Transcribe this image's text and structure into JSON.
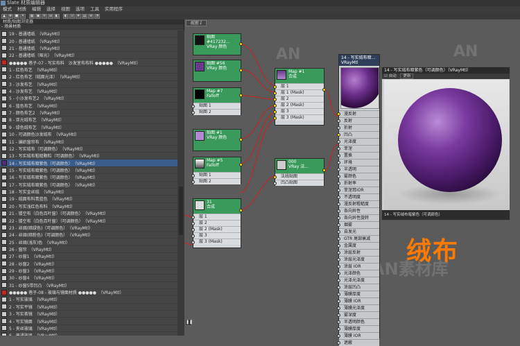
{
  "window_title": "Slate 材质编辑器",
  "menu": [
    "模式",
    "材质",
    "编辑",
    "选择",
    "视图",
    "选项",
    "工具",
    "实用程序"
  ],
  "toolbar_icons": [
    "select-icon",
    "pan-icon",
    "assign-icon",
    "delete-icon",
    "show-map-icon",
    "show-bg-icon",
    "layout-icon",
    "layout-child-icon",
    "nav-icon",
    "options-icon",
    "render-icon",
    "material-id-icon",
    "map-icon",
    "zoom-icon",
    "search-icon"
  ],
  "toolbar_labels": [
    "▲",
    "✥",
    "■",
    "✕",
    "▦",
    "▣",
    "≡",
    "⊞",
    "◧",
    "◐",
    "⊙",
    "#",
    "▤",
    "⊕",
    "◔"
  ],
  "left_panel": {
    "title": "材质/贴图浏览器",
    "section": "- 场景材质",
    "items": [
      {
        "label": "19 - 普通墙纸　（VRayMtl）",
        "color": "#cccccc"
      },
      {
        "label": "20 - 普通墙纸　（VRayMtl）",
        "color": "#cccccc"
      },
      {
        "label": "21 - 普通墙纸　（VRayMtl）",
        "color": "#cccccc"
      },
      {
        "label": "22 - 普通墙纸（哑光）　（VRayMtl）",
        "color": "#cccccc"
      },
      {
        "label": "●●●●● 巷子-07 - 写实布料　沙发室布布料 ●●●●●　（VRayMtl）",
        "color": "#cc2222"
      },
      {
        "label": "1 - 红色布艺　（VRayMtl）",
        "color": "#cccccc"
      },
      {
        "label": "2 - 红色布艺（绒面光泽）　（VRayMtl）",
        "color": "#cccccc"
      },
      {
        "label": "3 - 沙发布艺　（VRayMtl）",
        "color": "#cccccc"
      },
      {
        "label": "4 - 沙发布艺　（VRayMtl）",
        "color": "#cccccc"
      },
      {
        "label": "5 - 小沙发布艺2　（VRayMtl）",
        "color": "#cccccc"
      },
      {
        "label": "6 - 蓝色布艺　（VRayMtl）",
        "color": "#cccccc"
      },
      {
        "label": "7 - 颜色布艺2　（VRayMtl）",
        "color": "#cccccc"
      },
      {
        "label": "8 - 亚光绒布艺　（VRayMtl）",
        "color": "#cccccc"
      },
      {
        "label": "9 - 绿色绒布艺　（VRayMtl）",
        "color": "#cccccc"
      },
      {
        "label": "10 - 可调颜色沙发绒布　（VRayMtl）",
        "color": "#cccccc"
      },
      {
        "label": "11 - 编织窗帘布　（VRayMtl）",
        "color": "#cccccc"
      },
      {
        "label": "12 - 写实绒布（可调颜色）　（VRayMtl）",
        "color": "#cccccc"
      },
      {
        "label": "13 - 写实绒布粗糙颗粒（可调颜色）　（VRayMtl）",
        "color": "#cccccc"
      },
      {
        "label": "14 - 写实绒布暗紫色（可调颜色）　（VRayMtl）",
        "color": "#5a2a7a",
        "selected": true
      },
      {
        "label": "15 - 写实绒布暗紫色（可调颜色）　（VRayMtl）",
        "color": "#cccccc"
      },
      {
        "label": "16 - 写实绒布暗紫色（可调颜色）　（VRayMtl）",
        "color": "#cccccc"
      },
      {
        "label": "17 - 写实绒布暗紫色（可调颜色）　（VRayMtl）",
        "color": "#cccccc"
      },
      {
        "label": "18 - 写实金丝绒　（VRayMtl）",
        "color": "#cccccc"
      },
      {
        "label": "19 - 绒面布料青蓝色　（VRayMtl）",
        "color": "#cccccc"
      },
      {
        "label": "20 - 写实浅红色布料　（VRayMtl）",
        "color": "#cccccc"
      },
      {
        "label": "21 - 镂空布（白色百叶窗）（可调颜色）　（VRayMtl）",
        "color": "#cccccc"
      },
      {
        "label": "22 - 镂空布（白色百叶窗）（可调颜色）　（VRayMtl）",
        "color": "#cccccc"
      },
      {
        "label": "23 - 丝绸(暗绿色)（可调颜色）　（VRayMtl）",
        "color": "#cccccc"
      },
      {
        "label": "24 - 丝绸(暗粉色)（可调颜色）　（VRayMtl）",
        "color": "#cccccc"
      },
      {
        "label": "25 - 丝绸(浅灰)色　（VRayMtl）",
        "color": "#cccccc"
      },
      {
        "label": "26 - 窗帘　（VRayMtl）",
        "color": "#cccccc"
      },
      {
        "label": "27 - 纱窗1　（VRayMtl）",
        "color": "#cccccc"
      },
      {
        "label": "28 - 纱窗2　（VRayMtl）",
        "color": "#cccccc"
      },
      {
        "label": "29 - 纱窗3　（VRayMtl）",
        "color": "#cccccc"
      },
      {
        "label": "30 - 纱窗4　（VRayMtl）",
        "color": "#cccccc"
      },
      {
        "label": "31 - 纱窗5带凹凸　（VRayMtl）",
        "color": "#cccccc"
      },
      {
        "label": "●●●●● 巷子-08 - 玻璃与镜面材质 ●●●●●　（VRayMtl）",
        "color": "#cc2222"
      },
      {
        "label": "1 - 写实玻璃　（VRayMtl）",
        "color": "#cccccc"
      },
      {
        "label": "2 - 写实平镜　（VRayMtl）",
        "color": "#cccccc"
      },
      {
        "label": "3 - 写实茶镜　（VRayMtl）",
        "color": "#cccccc"
      },
      {
        "label": "4 - 写实镜面　（VRayMtl）",
        "color": "#cccccc"
      },
      {
        "label": "5 - 夹丝玻璃　（VRayMtl）",
        "color": "#cccccc"
      },
      {
        "label": "6 - 普通玻璃　（VRayMtl）",
        "color": "#cccccc"
      },
      {
        "label": "7 - 普通玻璃　（VRayMtl）",
        "color": "#cccccc"
      }
    ]
  },
  "view_tab": "视图 1",
  "nodes": {
    "map1": {
      "title": "贴图 #417232...",
      "subtitle": "VRay 颜色"
    },
    "map56": {
      "title": "贴图 #56",
      "subtitle": "VRay 颜色"
    },
    "map7": {
      "title": "Map #7",
      "subtitle": "Falloff",
      "rows": [
        "贴图 1",
        "贴图 2"
      ]
    },
    "map1b": {
      "title": "贴图 #1",
      "subtitle": "VRay 颜色"
    },
    "map5": {
      "title": "Map #5",
      "subtitle": "Falloff",
      "rows": [
        "贴图 1",
        "贴图 2"
      ]
    },
    "map31": {
      "title": "31",
      "subtitle": "合成",
      "rows": [
        "层 1",
        "层 2",
        "层 2 (Mask)",
        "层 3",
        "层 3 (Mask)"
      ]
    },
    "mapcomp": {
      "title": "Map #1",
      "subtitle": "合成",
      "rows": [
        "层 1",
        "层 1 (Mask)",
        "层 2",
        "层 2 (Mask)",
        "层 3",
        "层 3 (Mask)"
      ]
    },
    "vraynormal": {
      "title": "000",
      "subtitle": "VRay 法...",
      "rows": [
        "法线贴图",
        "凹凸贴图"
      ]
    },
    "main": {
      "title": "14 - 写实绒布暗...",
      "subtitle": "VRayMtl",
      "rows": [
        "漫反射",
        "反射",
        "折射",
        "凹凸",
        "光泽度",
        "菲涅",
        "置换",
        "环境",
        "半透明",
        "雾颜色",
        "折射率",
        "菲涅耳IOR",
        "不透明度",
        "漫反射粗糙度",
        "各向异性",
        "各向异性旋转",
        "烟雾",
        "自发光",
        "GTR 尾部衰减",
        "金属度",
        "涂层反射",
        "涂层光泽度",
        "涂层 IOR",
        "光泽颜色",
        "光泽光泽度",
        "涂层凹凸",
        "薄膜厚度",
        "薄膜 IOR",
        "薄膜光泽度",
        "雾深度",
        "半透明颜色",
        "薄膜厚度",
        "薄膜 IOR",
        "遮蔽"
      ]
    }
  },
  "preview": {
    "title": "14 - 写实绒布暗紫色（可调颜色）（VRayMtl）",
    "auto_label": "自动",
    "update_label": "更新",
    "footer": "14 - 写实绒布暗紫色（可调颜色）"
  },
  "overlay_text": "绒布",
  "watermarks": [
    "AN",
    "AN素材库"
  ],
  "colors": {
    "accent": "#ff7a00",
    "node_header": "#3a9a5c",
    "selection": "#3a5c8a"
  }
}
